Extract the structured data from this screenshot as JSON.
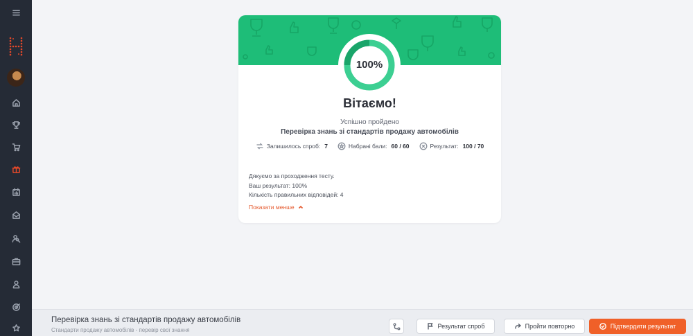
{
  "result_card": {
    "percent_label": "100%",
    "progress_fraction": 1.0,
    "title": "Вітаємо!",
    "subtitle": "Успішно пройдено",
    "test_name": "Перевірка знань зі стандартів продажу автомобілів",
    "stats": {
      "attempts_label": "Залишилось спроб:",
      "attempts_value": "7",
      "points_label": "Набрані бали:",
      "points_value": "60 / 60",
      "result_label": "Результат:",
      "result_value": "100 / 70"
    },
    "details": [
      "Дякуємо за проходження тесту.",
      "Ваш результат: 100%",
      "Кількість правильних відповідей: 4"
    ],
    "toggle_label": "Показати менше"
  },
  "footer": {
    "title": "Перевірка знань зі стандартів продажу автомобілів",
    "subtitle": "Стандарти продажу автомобілів - перевір свої знання",
    "attempts_button": "Результат спроб",
    "retry_button": "Пройти повторно",
    "confirm_button": "Підтвердити результат"
  },
  "colors": {
    "accent_green": "#1ebd78",
    "ring_green": "#3ccf92",
    "accent_orange": "#f06028",
    "sidebar_bg": "#252b36"
  }
}
